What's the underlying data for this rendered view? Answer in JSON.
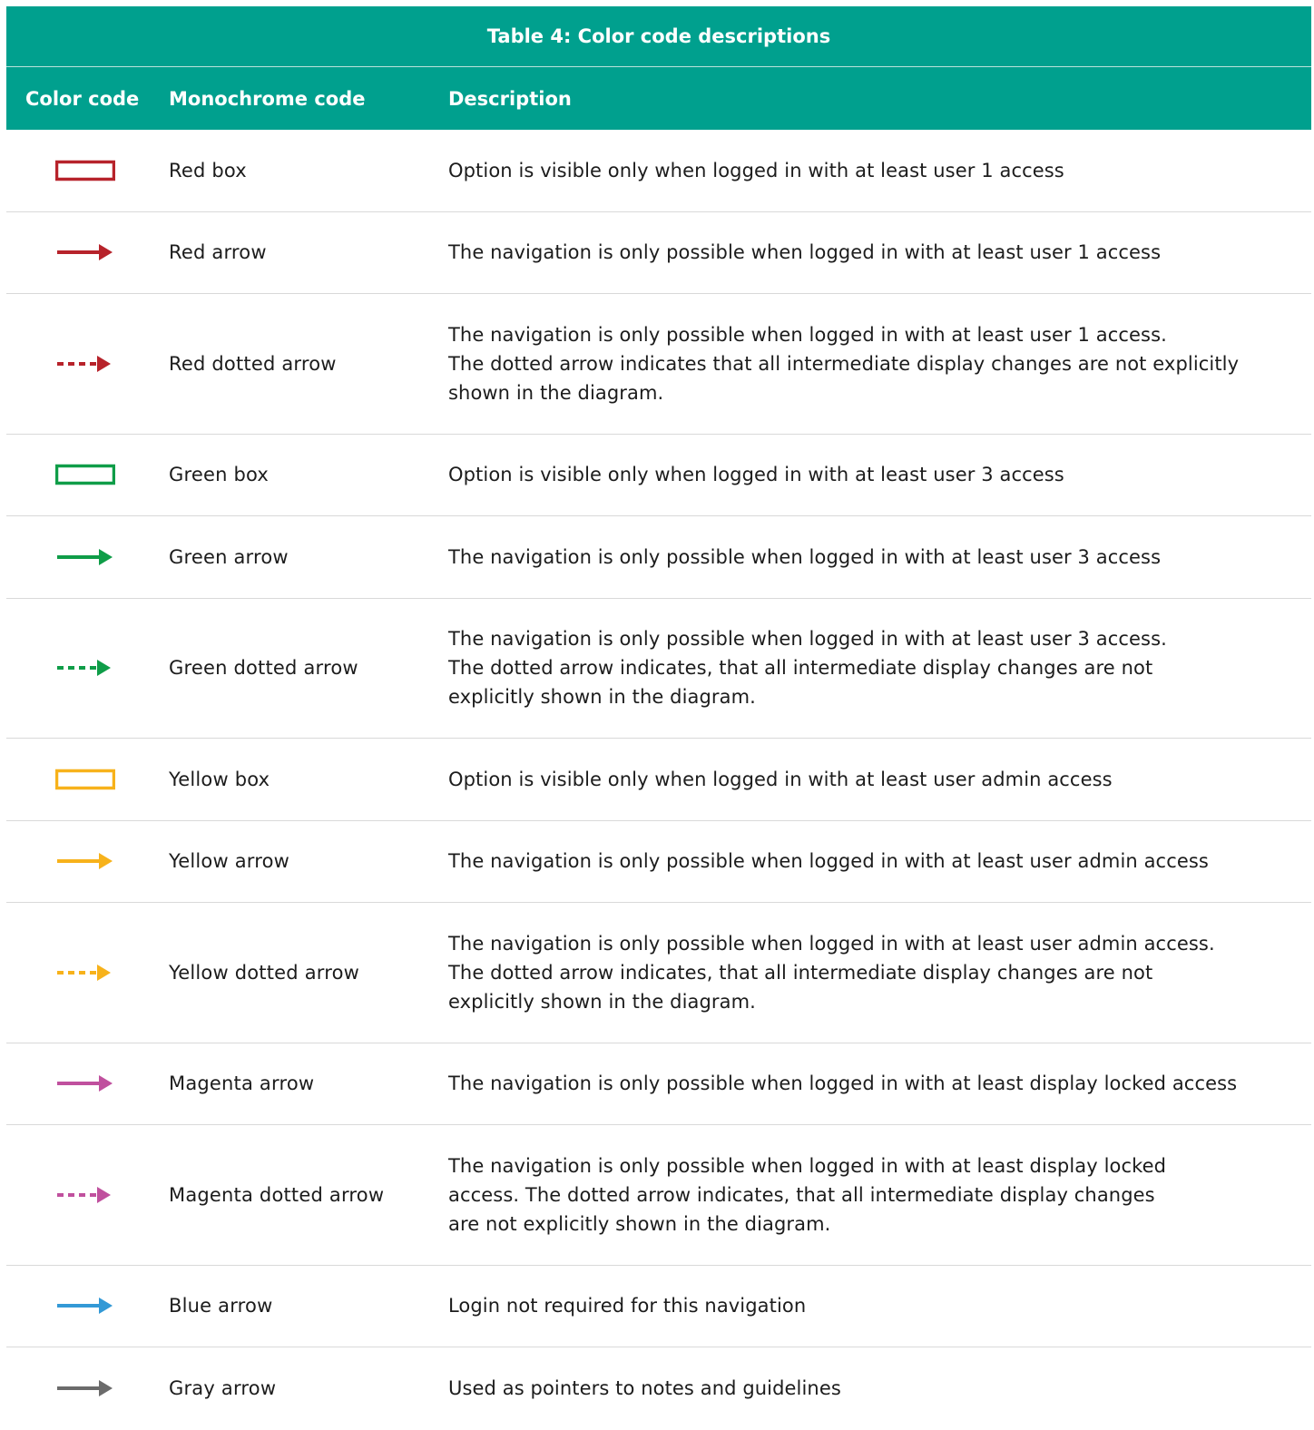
{
  "table": {
    "title": "Table 4: Color code descriptions",
    "headers": {
      "color_code": "Color code",
      "monochrome_code": "Monochrome code",
      "description": "Description"
    },
    "rows": [
      {
        "swatch": "box",
        "color": "#b7232b",
        "monochrome": "Red box",
        "description": [
          "Option is visible only when logged in with at least user 1 access"
        ]
      },
      {
        "swatch": "arrow",
        "color": "#b7232b",
        "monochrome": "Red arrow",
        "description": [
          "The navigation is only possible when logged in with at least user 1 access"
        ]
      },
      {
        "swatch": "dotted-arrow",
        "color": "#b7232b",
        "monochrome": "Red dotted arrow",
        "description": [
          "The navigation is only possible when logged in with at least user 1 access.",
          "The dotted arrow indicates that all intermediate display changes are not explicitly",
          "shown in the diagram."
        ]
      },
      {
        "swatch": "box",
        "color": "#0f9d48",
        "monochrome": "Green box",
        "description": [
          "Option is visible only when logged in with at least user 3 access"
        ]
      },
      {
        "swatch": "arrow",
        "color": "#0f9d48",
        "monochrome": "Green arrow",
        "description": [
          "The navigation is only possible when logged in with at least user 3 access"
        ]
      },
      {
        "swatch": "dotted-arrow",
        "color": "#0f9d48",
        "monochrome": "Green dotted arrow",
        "description": [
          "The navigation is only possible when logged in with at least user 3 access.",
          "The dotted arrow indicates, that all intermediate display changes are not",
          "explicitly shown in the diagram."
        ]
      },
      {
        "swatch": "box",
        "color": "#f7b21b",
        "monochrome": "Yellow box",
        "description": [
          "Option is visible only when logged in with at least user admin access"
        ]
      },
      {
        "swatch": "arrow",
        "color": "#f7b21b",
        "monochrome": "Yellow arrow",
        "description": [
          "The navigation is only possible when logged in with at least user admin access"
        ]
      },
      {
        "swatch": "dotted-arrow",
        "color": "#f7b21b",
        "monochrome": "Yellow dotted arrow",
        "description": [
          "The navigation is only possible when logged in with at least user admin access.",
          "The dotted arrow indicates, that all intermediate display changes are not",
          "explicitly shown in the diagram."
        ]
      },
      {
        "swatch": "arrow",
        "color": "#c0509e",
        "monochrome": "Magenta arrow",
        "description": [
          "The navigation is only possible when logged in with at least display locked access"
        ]
      },
      {
        "swatch": "dotted-arrow",
        "color": "#c0509e",
        "monochrome": "Magenta dotted arrow",
        "description": [
          "The navigation is only possible when logged in with at least display locked",
          "access. The dotted arrow indicates, that all intermediate display changes",
          "are not explicitly shown in the diagram."
        ]
      },
      {
        "swatch": "arrow",
        "color": "#3399d6",
        "monochrome": "Blue arrow",
        "description": [
          "Login not required for this navigation"
        ]
      },
      {
        "swatch": "arrow",
        "color": "#6b6b6b",
        "monochrome": "Gray arrow",
        "description": [
          "Used as pointers to notes and guidelines"
        ]
      }
    ]
  }
}
